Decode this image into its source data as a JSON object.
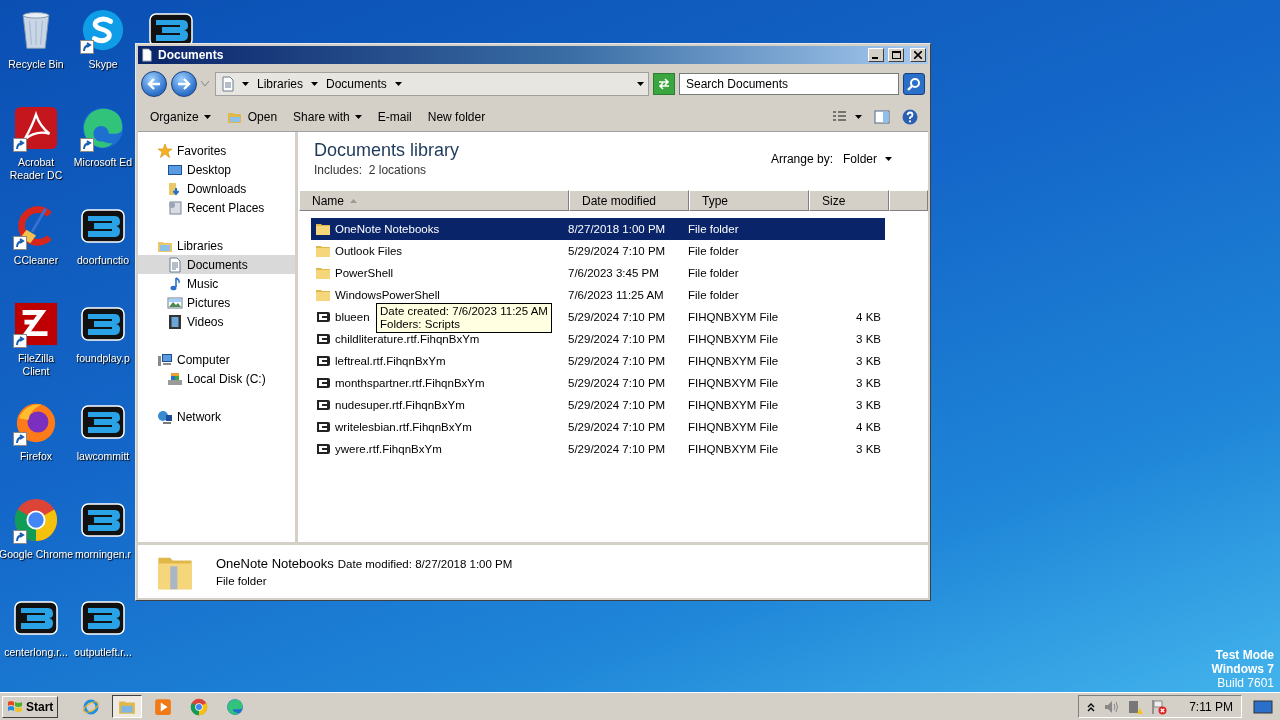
{
  "desktop_icons": [
    {
      "label": "Recycle Bin",
      "kind": "recycle"
    },
    {
      "label": "Acrobat Reader DC",
      "kind": "acrobat",
      "shortcut": true
    },
    {
      "label": "CCleaner",
      "kind": "ccleaner",
      "shortcut": true
    },
    {
      "label": "FileZilla Client",
      "kind": "filezilla",
      "shortcut": true
    },
    {
      "label": "Firefox",
      "kind": "firefox",
      "shortcut": true
    },
    {
      "label": "Google Chrome",
      "kind": "chrome",
      "shortcut": true
    },
    {
      "label": "centerlong.r...",
      "kind": "blogo"
    },
    {
      "label": "Skype",
      "kind": "skype",
      "shortcut": true
    },
    {
      "label": "Microsoft Ed",
      "kind": "edge",
      "shortcut": true
    },
    {
      "label": "doorfunctio",
      "kind": "blogo"
    },
    {
      "label": "foundplay.p",
      "kind": "blogo"
    },
    {
      "label": "lawcommitt",
      "kind": "blogo"
    },
    {
      "label": "morningen.r",
      "kind": "blogo"
    },
    {
      "label": "outputleft.r...",
      "kind": "blogo"
    },
    {
      "kind": "blogo"
    }
  ],
  "window": {
    "title": "Documents"
  },
  "address": {
    "crumbs": [
      "Libraries",
      "Documents"
    ]
  },
  "search": {
    "placeholder": "Search Documents"
  },
  "commands": [
    {
      "label": "Organize",
      "kind": "menu"
    },
    {
      "label": "Open",
      "kind": "open"
    },
    {
      "label": "Share with",
      "kind": "menu"
    },
    {
      "label": "E-mail",
      "kind": "plain"
    },
    {
      "label": "New folder",
      "kind": "plain"
    }
  ],
  "nav": [
    {
      "label": "Favorites",
      "kind": "star",
      "selected": false,
      "children": [
        {
          "label": "Desktop",
          "kind": "desktop",
          "selected": false
        },
        {
          "label": "Downloads",
          "kind": "downloads",
          "selected": false
        },
        {
          "label": "Recent Places",
          "kind": "recent",
          "selected": false
        }
      ]
    },
    {
      "label": "Libraries",
      "kind": "libraries",
      "selected": false,
      "children": [
        {
          "label": "Documents",
          "kind": "documents",
          "selected": true
        },
        {
          "label": "Music",
          "kind": "music",
          "selected": false
        },
        {
          "label": "Pictures",
          "kind": "pictures",
          "selected": false
        },
        {
          "label": "Videos",
          "kind": "videos",
          "selected": false
        }
      ]
    },
    {
      "label": "Computer",
      "kind": "computer",
      "selected": false,
      "children": [
        {
          "label": "Local Disk (C:)",
          "kind": "disk",
          "selected": false
        }
      ]
    },
    {
      "label": "Network",
      "kind": "network",
      "selected": false
    }
  ],
  "library": {
    "title": "Documents library",
    "includes_label": "Includes:",
    "includes": "2 locations",
    "arrange_label": "Arrange by:",
    "arrange_value": "Folder"
  },
  "columns": [
    {
      "label": "Name",
      "sorted": true
    },
    {
      "label": "Date modified",
      "sorted": false
    },
    {
      "label": "Type",
      "sorted": false
    },
    {
      "label": "Size",
      "sorted": false
    }
  ],
  "rows": [
    {
      "name": "OneNote Notebooks",
      "date": "8/27/2018 1:00 PM",
      "type": "File folder",
      "kind": "folder",
      "selected": true
    },
    {
      "name": "Outlook Files",
      "date": "5/29/2024 7:10 PM",
      "type": "File folder",
      "kind": "folder",
      "selected": false
    },
    {
      "name": "PowerShell",
      "date": "7/6/2023 3:45 PM",
      "type": "File folder",
      "kind": "folder",
      "selected": false
    },
    {
      "name": "WindowsPowerShell",
      "date": "7/6/2023 11:25 AM",
      "type": "File folder",
      "kind": "folder",
      "selected": false
    },
    {
      "name": "blueen",
      "date": "5/29/2024 7:10 PM",
      "type": "FIHQNBXYM File",
      "size": "4 KB",
      "kind": "file",
      "selected": false
    },
    {
      "name": "childliterature.rtf.FihqnBxYm",
      "date": "5/29/2024 7:10 PM",
      "type": "FIHQNBXYM File",
      "size": "3 KB",
      "kind": "file",
      "selected": false
    },
    {
      "name": "leftreal.rtf.FihqnBxYm",
      "date": "5/29/2024 7:10 PM",
      "type": "FIHQNBXYM File",
      "size": "3 KB",
      "kind": "file",
      "selected": false
    },
    {
      "name": "monthspartner.rtf.FihqnBxYm",
      "date": "5/29/2024 7:10 PM",
      "type": "FIHQNBXYM File",
      "size": "3 KB",
      "kind": "file",
      "selected": false
    },
    {
      "name": "nudesuper.rtf.FihqnBxYm",
      "date": "5/29/2024 7:10 PM",
      "type": "FIHQNBXYM File",
      "size": "3 KB",
      "kind": "file",
      "selected": false
    },
    {
      "name": "writelesbian.rtf.FihqnBxYm",
      "date": "5/29/2024 7:10 PM",
      "type": "FIHQNBXYM File",
      "size": "4 KB",
      "kind": "file",
      "selected": false
    },
    {
      "name": "ywere.rtf.FihqnBxYm",
      "date": "5/29/2024 7:10 PM",
      "type": "FIHQNBXYM File",
      "size": "3 KB",
      "kind": "file",
      "selected": false
    }
  ],
  "tooltip": {
    "lines": [
      "Date created: 7/6/2023 11:25 AM",
      "Folders: Scripts"
    ]
  },
  "details": {
    "name": "OneNote Notebooks",
    "date_label": "Date modified:",
    "date": "8/27/2018 1:00 PM",
    "type": "File folder"
  },
  "test_mode": [
    "Test Mode",
    "Windows 7",
    "Build 7601"
  ],
  "taskbar": {
    "start": "Start",
    "apps": [
      {
        "kind": "ie",
        "active": false
      },
      {
        "kind": "explorer",
        "active": true
      },
      {
        "kind": "media",
        "active": false
      },
      {
        "kind": "chrome",
        "active": false
      },
      {
        "kind": "edge",
        "active": false
      }
    ],
    "clock": "7:11 PM"
  }
}
